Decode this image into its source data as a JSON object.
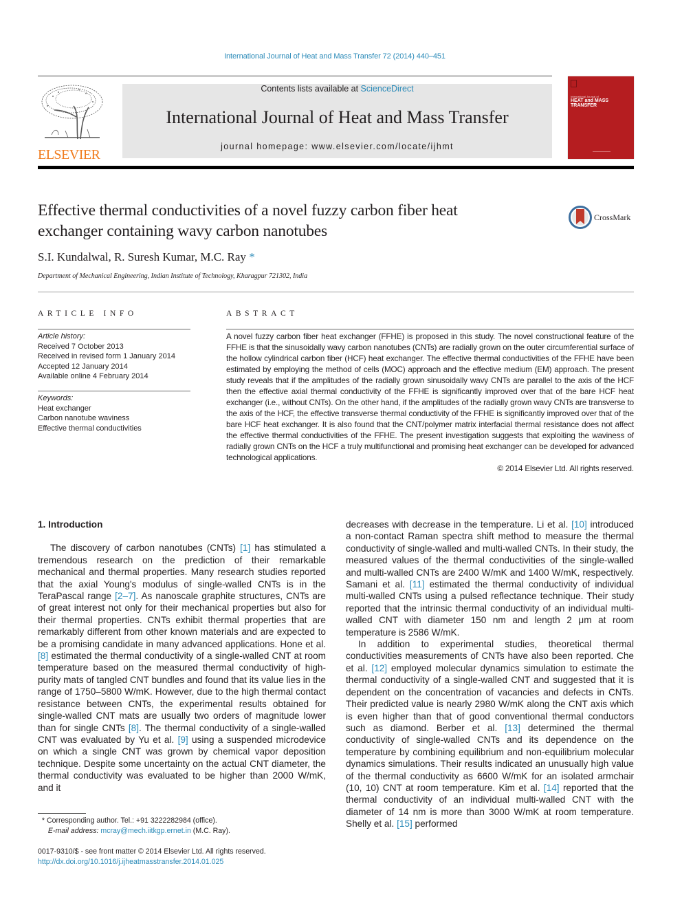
{
  "running_header": {
    "citation": "International Journal of Heat and Mass Transfer 72 (2014) 440–451"
  },
  "masthead": {
    "publisher_logo": "ELSEVIER",
    "contents_prefix": "Contents lists available at ",
    "contents_link": "ScienceDirect",
    "journal_title": "International Journal of Heat and Mass Transfer",
    "homepage_prefix": "journal homepage: ",
    "homepage_url": "www.elsevier.com/locate/ijhmt",
    "cover": {
      "small_text": "International Journal of",
      "big_line1": "HEAT and MASS",
      "big_line2": "TRANSFER",
      "color": "#b51d20"
    }
  },
  "article": {
    "title_line1": "Effective thermal conductivities of a novel fuzzy carbon fiber heat",
    "title_line2": "exchanger containing wavy carbon nanotubes",
    "crossmark_label": "CrossMark",
    "authors": "S.I. Kundalwal, R. Suresh Kumar, M.C. Ray",
    "corresponding_mark": "*",
    "affiliation": "Department of Mechanical Engineering, Indian Institute of Technology, Kharagpur 721302, India"
  },
  "article_info": {
    "heading": "ARTICLE INFO",
    "history_label": "Article history:",
    "history": [
      "Received 7 October 2013",
      "Received in revised form 1 January 2014",
      "Accepted 12 January 2014",
      "Available online 4 February 2014"
    ],
    "keywords_label": "Keywords:",
    "keywords": [
      "Heat exchanger",
      "Carbon nanotube waviness",
      "Effective thermal conductivities"
    ]
  },
  "abstract": {
    "heading": "ABSTRACT",
    "text": "A novel fuzzy carbon fiber heat exchanger (FFHE) is proposed in this study. The novel constructional feature of the FFHE is that the sinusoidally wavy carbon nanotubes (CNTs) are radially grown on the outer circumferential surface of the hollow cylindrical carbon fiber (HCF) heat exchanger. The effective thermal conductivities of the FFHE have been estimated by employing the method of cells (MOC) approach and the effective medium (EM) approach. The present study reveals that if the amplitudes of the radially grown sinusoidally wavy CNTs are parallel to the axis of the HCF then the effective axial thermal conductivity of the FFHE is significantly improved over that of the bare HCF heat exchanger (i.e., without CNTs). On the other hand, if the amplitudes of the radially grown wavy CNTs are transverse to the axis of the HCF, the effective transverse thermal conductivity of the FFHE is significantly improved over that of the bare HCF heat exchanger. It is also found that the CNT/polymer matrix interfacial thermal resistance does not affect the effective thermal conductivities of the FFHE. The present investigation suggests that exploiting the waviness of radially grown CNTs on the HCF a truly multifunctional and promising heat exchanger can be developed for advanced technological applications.",
    "copyright": "© 2014 Elsevier Ltd. All rights reserved."
  },
  "body": {
    "section_heading": "1. Introduction",
    "left": {
      "s1": "The discovery of carbon nanotubes (CNTs) ",
      "r1": "[1]",
      "s2": " has stimulated a tremendous research on the prediction of their remarkable mechanical and thermal properties. Many research studies reported that the axial Young's modulus of single-walled CNTs is in the TeraPascal range ",
      "r2": "[2–7]",
      "s3": ". As nanoscale graphite structures, CNTs are of great interest not only for their mechanical properties but also for their thermal properties. CNTs exhibit thermal properties that are remarkably different from other known materials and are expected to be a promising candidate in many advanced applications. Hone et al. ",
      "r3": "[8]",
      "s4": " estimated the thermal conductivity of a single-walled CNT at room temperature based on the measured thermal conductivity of high-purity mats of tangled CNT bundles and found that its value lies in the range of 1750–5800 W/mK. However, due to the high thermal contact resistance between CNTs, the experimental results obtained for single-walled CNT mats are usually two orders of magnitude lower than for single CNTs ",
      "r4": "[8]",
      "s5": ". The thermal conductivity of a single-walled CNT was evaluated by Yu et al. ",
      "r5": "[9]",
      "s6": " using a suspended microdevice on which a single CNT was grown by chemical vapor deposition technique. Despite some uncertainty on the actual CNT diameter, the thermal conductivity was evaluated to be higher than 2000 W/mK, and it"
    },
    "right": {
      "p1": {
        "s1": "decreases with decrease in the temperature. Li et al. ",
        "r1": "[10]",
        "s2": " introduced a non-contact Raman spectra shift method to measure the thermal conductivity of single-walled and multi-walled CNTs. In their study, the measured values of the thermal conductivities of the single-walled and multi-walled CNTs are 2400 W/mK and 1400 W/mK, respectively. Samani et al. ",
        "r2": "[11]",
        "s3": " estimated the thermal conductivity of individual multi-walled CNTs using a pulsed reflectance technique. Their study reported that the intrinsic thermal conductivity of an individual multi-walled CNT with diameter 150 nm and length 2 μm at room temperature is 2586 W/mK."
      },
      "p2": {
        "s1": "In addition to experimental studies, theoretical thermal conductivities measurements of CNTs have also been reported. Che et al. ",
        "r1": "[12]",
        "s2": " employed molecular dynamics simulation to estimate the thermal conductivity of a single-walled CNT and suggested that it is dependent on the concentration of vacancies and defects in CNTs. Their predicted value is nearly 2980 W/mK along the CNT axis which is even higher than that of good conventional thermal conductors such as diamond. Berber et al. ",
        "r2": "[13]",
        "s3": " determined the thermal conductivity of single-walled CNTs and its dependence on the temperature by combining equilibrium and non-equilibrium molecular dynamics simulations. Their results indicated an unusually high value of the thermal conductivity as 6600 W/mK for an isolated armchair (10, 10) CNT at room temperature. Kim et al. ",
        "r3": "[14]",
        "s4": " reported that the thermal conductivity of an individual multi-walled CNT with the diameter of 14 nm is more than 3000 W/mK at room temperature. Shelly et al. ",
        "r4": "[15]",
        "s5": " performed"
      }
    }
  },
  "footnote": {
    "mark": "*",
    "corresponding": " Corresponding author. Tel.: +91 3222282984 (office).",
    "email_label": "E-mail address: ",
    "email": "mcray@mech.iitkgp.ernet.in",
    "email_suffix": " (M.C. Ray)."
  },
  "front_matter": {
    "issn_line": "0017-9310/$ - see front matter © 2014 Elsevier Ltd. All rights reserved.",
    "doi": "http://dx.doi.org/10.1016/j.ijheatmasstransfer.2014.01.025"
  },
  "colors": {
    "link": "#2a8ab8",
    "elsevier_orange": "#f07c1e",
    "banner_gray": "#e6e6e6",
    "cover_red": "#b51d20"
  }
}
